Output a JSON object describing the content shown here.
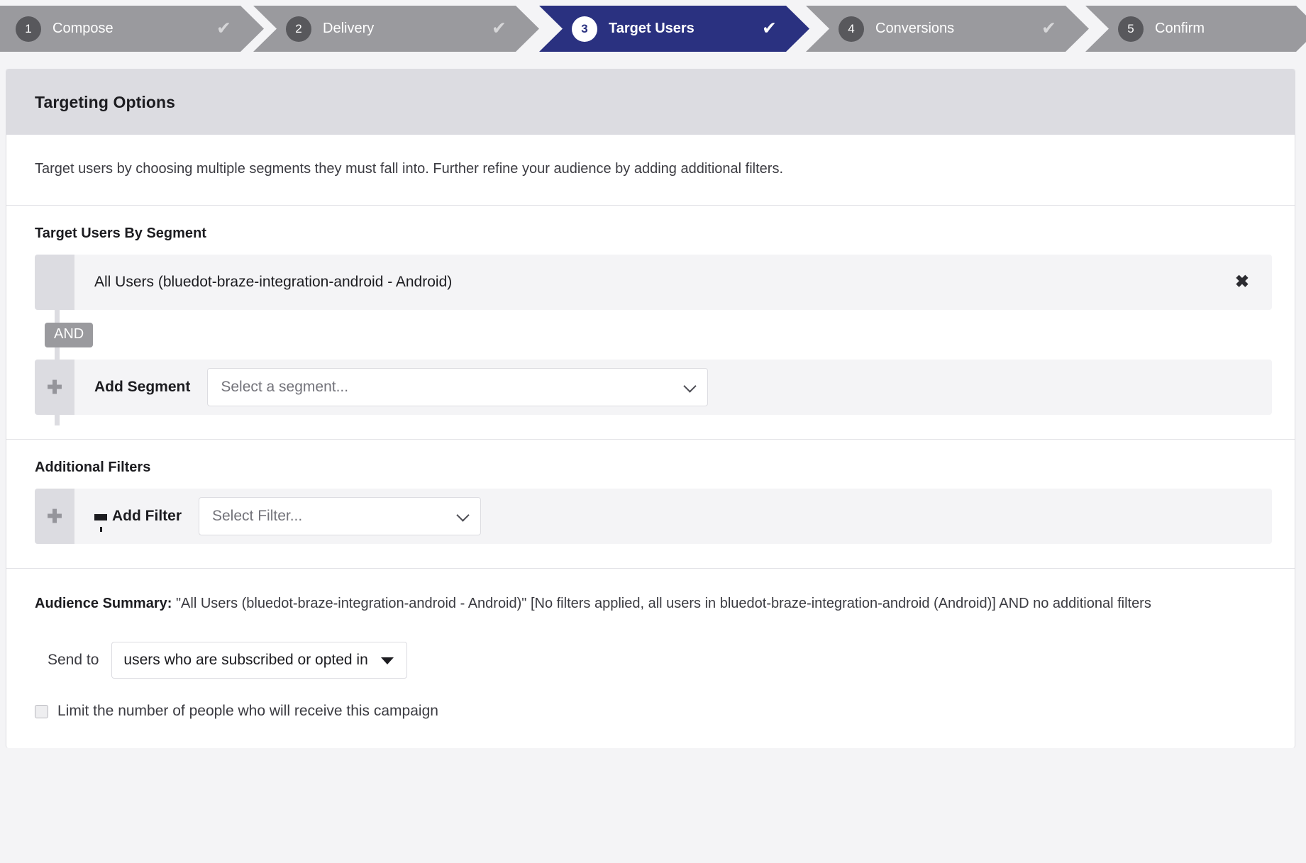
{
  "steps": [
    {
      "number": "1",
      "label": "Compose",
      "check": "✔",
      "state": "done"
    },
    {
      "number": "2",
      "label": "Delivery",
      "check": "✔",
      "state": "done"
    },
    {
      "number": "3",
      "label": "Target Users",
      "check": "✔",
      "state": "active"
    },
    {
      "number": "4",
      "label": "Conversions",
      "check": "✔",
      "state": "done"
    },
    {
      "number": "5",
      "label": "Confirm",
      "check": "",
      "state": "todo"
    }
  ],
  "panel": {
    "header_title": "Targeting Options",
    "intro": "Target users by choosing multiple segments they must fall into. Further refine your audience by adding additional filters."
  },
  "segments": {
    "section_title": "Target Users By Segment",
    "selected_segment": "All Users (bluedot-braze-integration-android - Android)",
    "remove_glyph": "✖",
    "operator": "AND",
    "add_handle_glyph": "✚",
    "add_label": "Add Segment",
    "select_placeholder": "Select a segment..."
  },
  "filters": {
    "section_title": "Additional Filters",
    "add_handle_glyph": "✚",
    "add_label": "Add Filter",
    "select_placeholder": "Select Filter..."
  },
  "audience": {
    "summary_label": "Audience Summary:",
    "summary_text": "\"All Users (bluedot-braze-integration-android - Android)\" [No filters applied, all users in bluedot-braze-integration-android (Android)] AND no additional filters",
    "send_to_label": "Send to",
    "send_to_value": "users who are subscribed or opted in",
    "limit_checkbox_label": "Limit the number of people who will receive this campaign"
  },
  "colors": {
    "active_step": "#2a3180",
    "inactive_step": "#9a9a9e",
    "page_background": "#f4f4f6",
    "panel_header": "#dcdce1"
  }
}
